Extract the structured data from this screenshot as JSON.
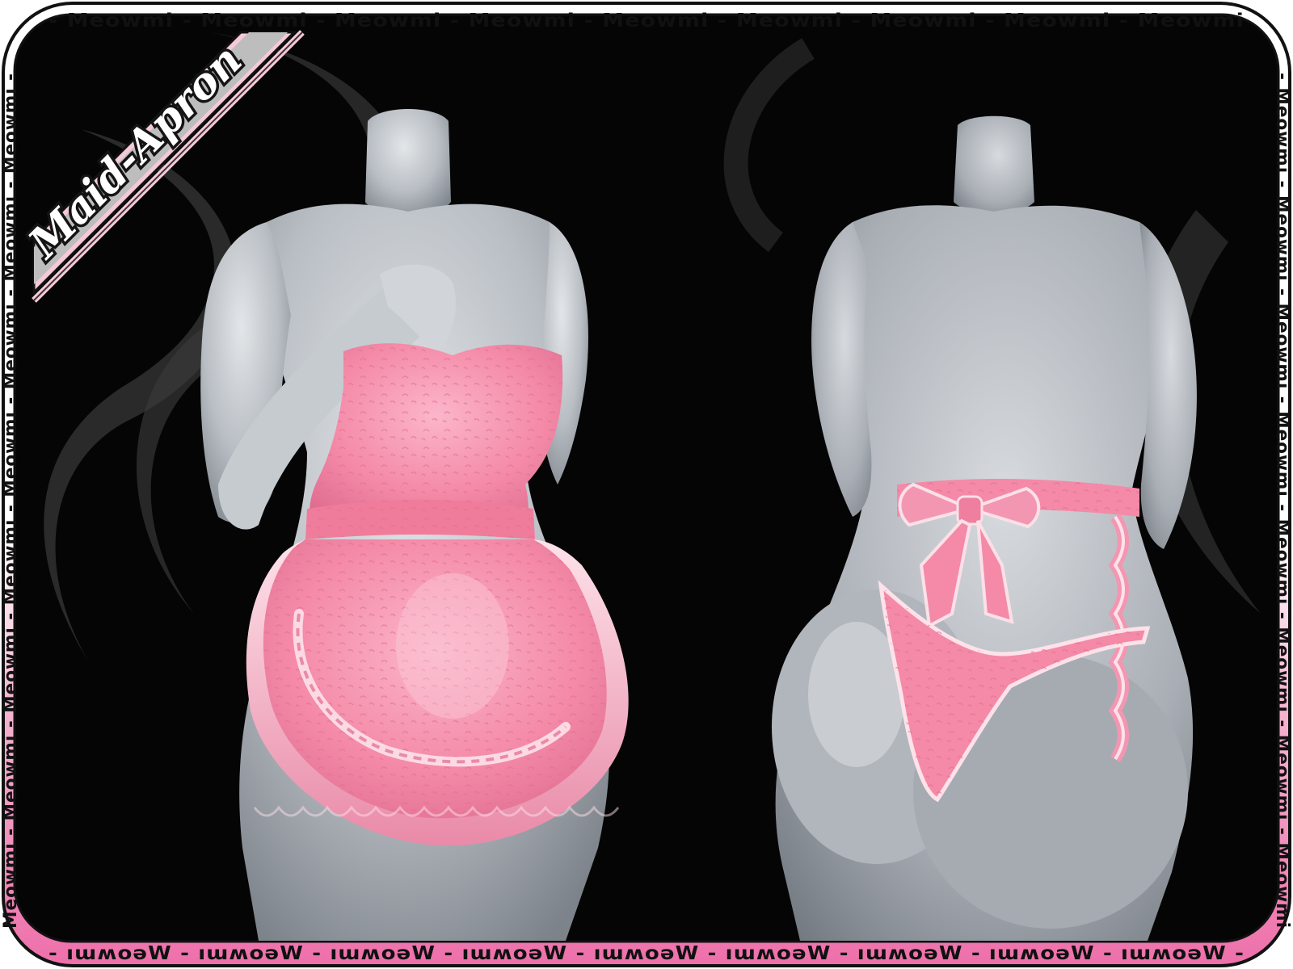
{
  "banner": {
    "title": "Maid-Apron"
  },
  "watermark": {
    "top_text": "- Meowmi - Meowmi - Meowmi - Meowmi - Meowmi - Meowmi - Meowmi - Meowmi - Meowmi",
    "bottom_text": "- ıɯʍoǝW - ıɯʍoǝW - ıɯʍoǝW - ıɯʍoǝW - ıɯʍoǝW - ıɯʍoǝW - ıɯʍoǝW - ıɯʍoǝW - ıɯʍoǝW -",
    "left_text": "Meowmi - Meowmi - Meowmi - Meowmi - Meowmi - Meowmi - Meowmi - Meowmi -",
    "right_text": "- Meowmi - Meowmi - Meowmi - Meowmi - Meowmi - Meowmi - Meowmi - Meowmi"
  },
  "colors": {
    "background": "#050505",
    "frame_top": "#ffffff",
    "frame_bottom": "#f080b8",
    "banner_fill": "#bdbdbd",
    "banner_stripe": "#f6c9d8",
    "apron_pink": "#f48aa8",
    "apron_light": "#fbbfd0",
    "mannequin": "#b9bec4",
    "mannequin_light": "#dde0e3",
    "mannequin_shadow": "#7e848b"
  },
  "icons": {
    "front_view": "mannequin-front-apron-icon",
    "back_view": "mannequin-back-apron-icon"
  }
}
